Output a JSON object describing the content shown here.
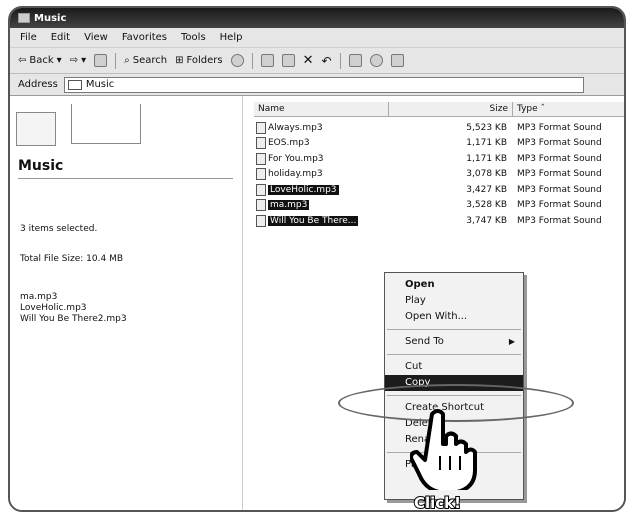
{
  "window": {
    "title": "Music"
  },
  "menu": [
    "File",
    "Edit",
    "View",
    "Favorites",
    "Tools",
    "Help"
  ],
  "toolbar": {
    "back": "Back",
    "search": "Search",
    "folders": "Folders"
  },
  "address": {
    "label": "Address",
    "value": "Music"
  },
  "left_panel": {
    "folder_name": "Music",
    "selected_count": "3 items selected.",
    "total_size": "Total File Size: 10.4 MB",
    "selected_files": [
      "ma.mp3",
      "LoveHolic.mp3",
      "Will You Be There2.mp3"
    ]
  },
  "columns": {
    "name": "Name",
    "size": "Size",
    "type": "Type"
  },
  "files": [
    {
      "name": "Always.mp3",
      "size": "5,523 KB",
      "type": "MP3 Format Sound",
      "selected": false
    },
    {
      "name": "EOS.mp3",
      "size": "1,171 KB",
      "type": "MP3 Format Sound",
      "selected": false
    },
    {
      "name": "For You.mp3",
      "size": "1,171 KB",
      "type": "MP3 Format Sound",
      "selected": false
    },
    {
      "name": "holiday.mp3",
      "size": "3,078 KB",
      "type": "MP3 Format Sound",
      "selected": false
    },
    {
      "name": "LoveHolic.mp3",
      "size": "3,427 KB",
      "type": "MP3 Format Sound",
      "selected": true
    },
    {
      "name": "ma.mp3",
      "size": "3,528 KB",
      "type": "MP3 Format Sound",
      "selected": true
    },
    {
      "name": "Will You Be There...",
      "size": "3,747 KB",
      "type": "MP3 Format Sound",
      "selected": true
    }
  ],
  "context_menu": {
    "open": "Open",
    "play": "Play",
    "open_with": "Open With...",
    "send_to": "Send To",
    "cut": "Cut",
    "copy": "Copy",
    "shortcut": "Create Shortcut",
    "delete": "Delete",
    "rename": "Rename",
    "properties": "Properties"
  },
  "callout": "Click!"
}
